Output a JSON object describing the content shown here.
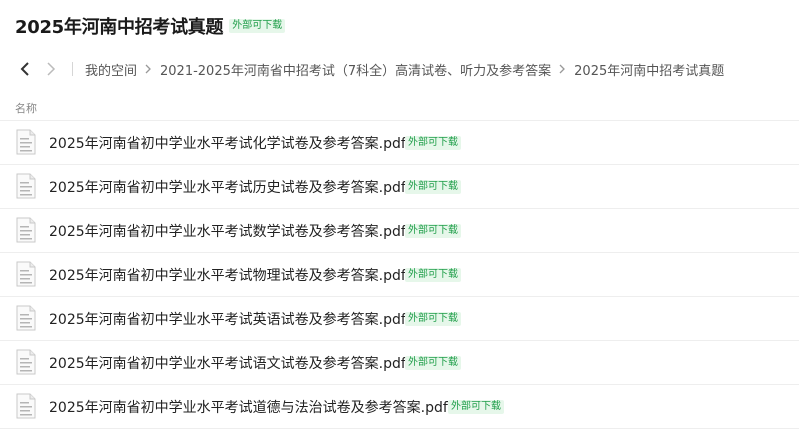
{
  "header": {
    "title": "2025年河南中招考试真题",
    "badge": "外部可下载"
  },
  "breadcrumb": {
    "back_icon": "chevron-left-icon",
    "forward_icon": "chevron-right-icon",
    "items": [
      "我的空间",
      "2021-2025年河南省中招考试（7科全）高清试卷、听力及参考答案",
      "2025年河南中招考试真题"
    ]
  },
  "list": {
    "column_header": "名称",
    "badge_label": "外部可下载",
    "files": [
      {
        "name": "2025年河南省初中学业水平考试化学试卷及参考答案.pdf",
        "icon": "pdf-file-icon"
      },
      {
        "name": "2025年河南省初中学业水平考试历史试卷及参考答案.pdf",
        "icon": "pdf-file-icon"
      },
      {
        "name": "2025年河南省初中学业水平考试数学试卷及参考答案.pdf",
        "icon": "pdf-file-icon"
      },
      {
        "name": "2025年河南省初中学业水平考试物理试卷及参考答案.pdf",
        "icon": "pdf-file-icon"
      },
      {
        "name": "2025年河南省初中学业水平考试英语试卷及参考答案.pdf",
        "icon": "pdf-file-icon"
      },
      {
        "name": "2025年河南省初中学业水平考试语文试卷及参考答案.pdf",
        "icon": "pdf-file-icon"
      },
      {
        "name": "2025年河南省初中学业水平考试道德与法治试卷及参考答案.pdf",
        "icon": "pdf-file-icon"
      }
    ]
  },
  "colors": {
    "badge_bg": "#e6f7ea",
    "badge_text": "#1f9e49",
    "divider": "#eeeeee"
  }
}
